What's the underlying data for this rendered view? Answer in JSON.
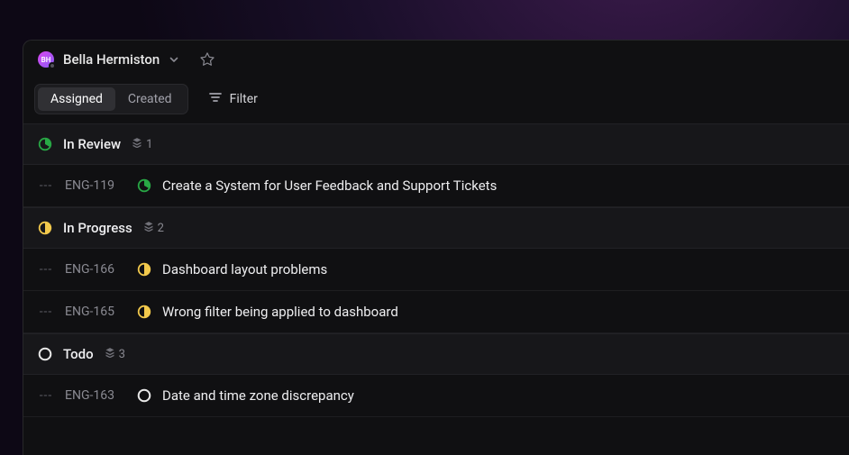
{
  "header": {
    "avatar_initials": "BH",
    "user_name": "Bella Hermiston"
  },
  "toolbar": {
    "tabs": {
      "assigned": "Assigned",
      "created": "Created"
    },
    "active_tab": "assigned",
    "filter_label": "Filter"
  },
  "groups": [
    {
      "status": "in_review",
      "title": "In Review",
      "count": "1",
      "issues": [
        {
          "id": "ENG-119",
          "title": "Create a System for User Feedback and Support Tickets",
          "status": "in_review"
        }
      ]
    },
    {
      "status": "in_progress",
      "title": "In Progress",
      "count": "2",
      "issues": [
        {
          "id": "ENG-166",
          "title": "Dashboard layout problems",
          "status": "in_progress"
        },
        {
          "id": "ENG-165",
          "title": "Wrong filter being applied to dashboard",
          "status": "in_progress"
        }
      ]
    },
    {
      "status": "todo",
      "title": "Todo",
      "count": "3",
      "issues": [
        {
          "id": "ENG-163",
          "title": "Date and time zone discrepancy",
          "status": "todo"
        }
      ]
    }
  ],
  "priority_placeholder": "---",
  "colors": {
    "in_review": "#28a745",
    "in_progress": "#f2c94c",
    "todo": "#e8e8e8"
  }
}
